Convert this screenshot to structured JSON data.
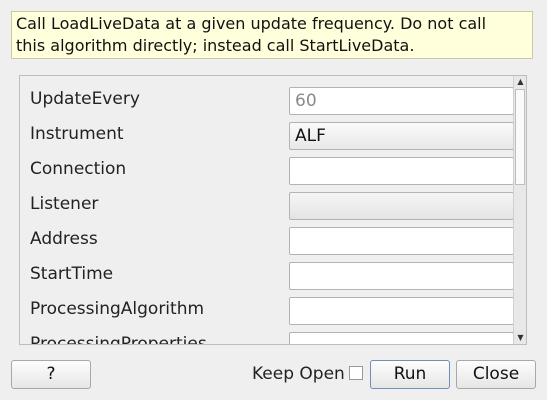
{
  "description": {
    "line1": "Call LoadLiveData at a given update frequency. Do not call",
    "line2": "this algorithm directly; instead call StartLiveData."
  },
  "properties": [
    {
      "label": "UpdateEvery",
      "value": "60",
      "state": "disabled"
    },
    {
      "label": "Instrument",
      "value": "ALF",
      "state": "combo"
    },
    {
      "label": "Connection",
      "value": "",
      "state": "text"
    },
    {
      "label": "Listener",
      "value": "",
      "state": "combo-empty"
    },
    {
      "label": "Address",
      "value": "",
      "state": "text"
    },
    {
      "label": "StartTime",
      "value": "",
      "state": "text"
    },
    {
      "label": "ProcessingAlgorithm",
      "value": "",
      "state": "text"
    },
    {
      "label": "ProcessingProperties",
      "value": "",
      "state": "text"
    }
  ],
  "buttons": {
    "help": "?",
    "keep_open": "Keep Open",
    "run": "Run",
    "close": "Close"
  },
  "keep_open_checked": false,
  "icons": {
    "scroll_up": "up-arrow-icon",
    "scroll_down": "down-arrow-icon"
  }
}
